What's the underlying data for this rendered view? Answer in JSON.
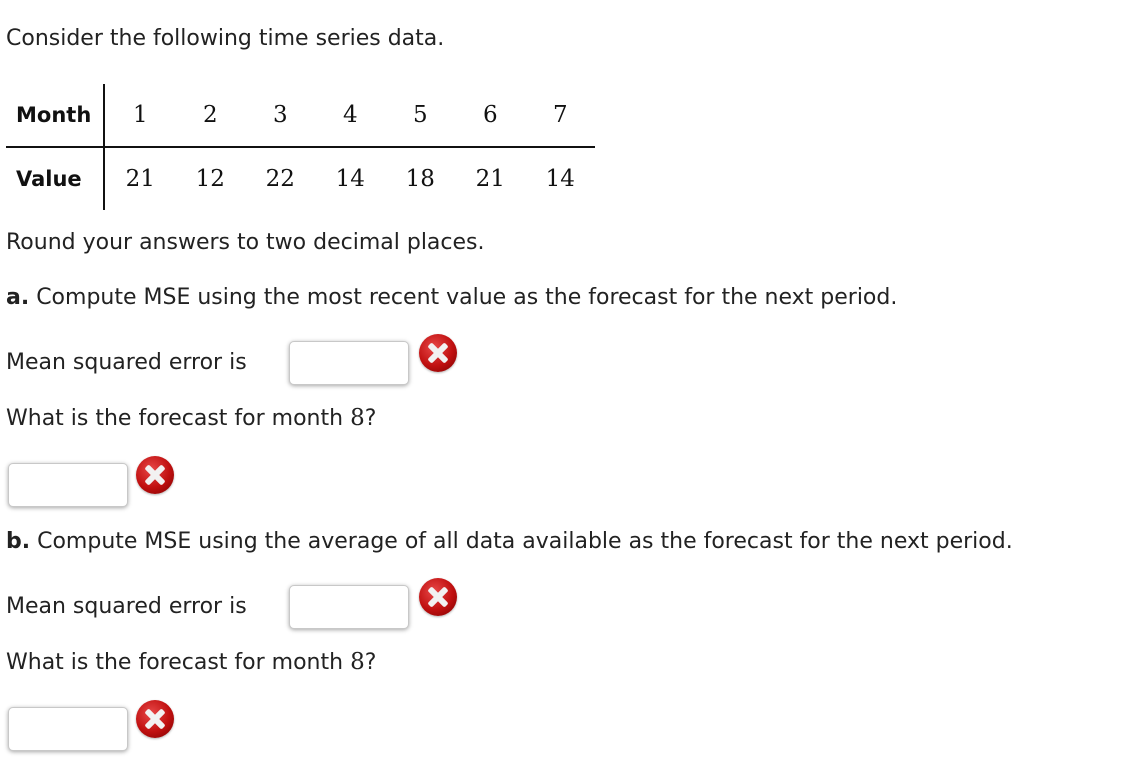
{
  "intro": "Consider the following time series data.",
  "table": {
    "row_headers": [
      "Month",
      "Value"
    ],
    "months": [
      "1",
      "2",
      "3",
      "4",
      "5",
      "6",
      "7"
    ],
    "values": [
      "21",
      "12",
      "22",
      "14",
      "18",
      "21",
      "14"
    ]
  },
  "instruction": "Round your answers to two decimal places.",
  "part_a": {
    "label": "a.",
    "question": " Compute MSE using the most recent value as the forecast for the next period.",
    "mse_label": "Mean squared error is",
    "mse_value": "",
    "forecast_q_prefix": "What is the forecast for month ",
    "forecast_month": "8",
    "forecast_q_suffix": "?",
    "forecast_value": ""
  },
  "part_b": {
    "label": "b.",
    "question": " Compute MSE using the average of all data available as the forecast for the next period.",
    "mse_label": "Mean squared error is",
    "mse_value": "",
    "forecast_q_prefix": "What is the forecast for month ",
    "forecast_month": "8",
    "forecast_q_suffix": "?",
    "forecast_value": ""
  },
  "icons": {
    "incorrect": "incorrect-x-icon"
  }
}
